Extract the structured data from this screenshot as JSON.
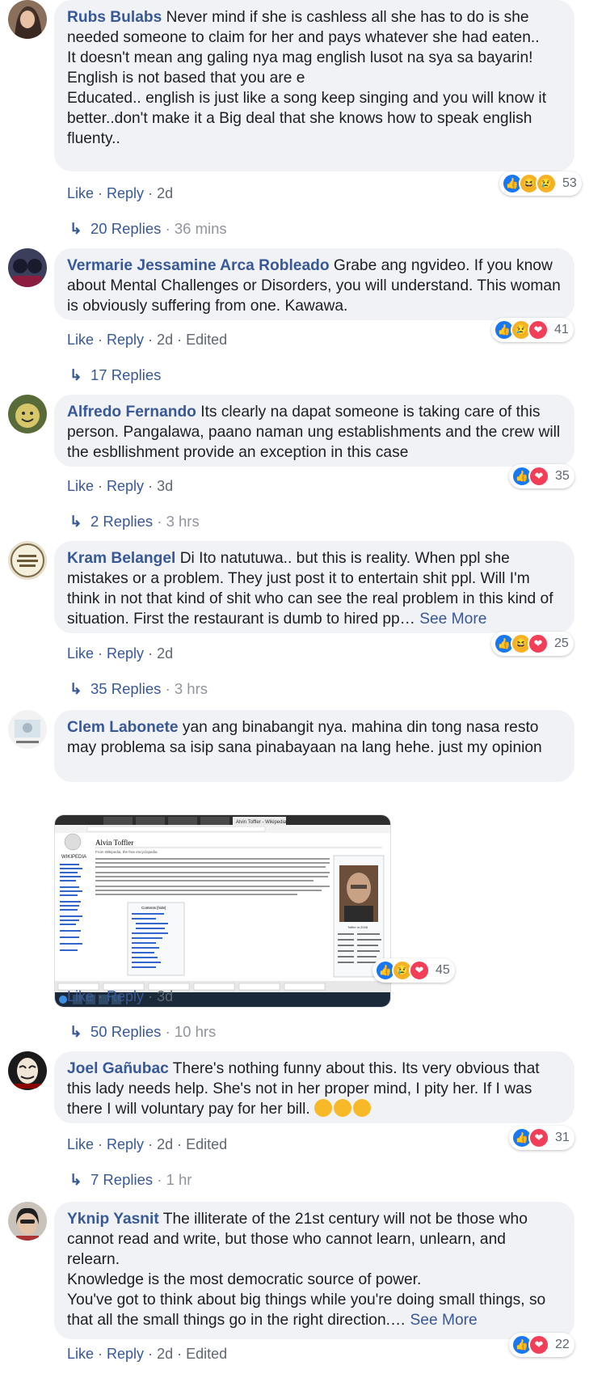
{
  "actions": {
    "like": "Like",
    "reply": "Reply",
    "edited": "Edited",
    "see_more": "See More"
  },
  "comments": [
    {
      "author": "Rubs Bulabs",
      "text": " Never mind if she is cashless all she has to do is she needed someone to claim for her and pays whatever she had eaten..\nIt doesn't mean ang galing nya mag english lusot na sya sa bayarin!\nEnglish is not based that you are e\nEducated.. english is just like a song keep singing and you will know it better..don't make it a Big deal that she knows how to speak english fluenty..",
      "time": "2d",
      "reaction_count": "53",
      "replies": "20 Replies",
      "replies_time": "36 mins"
    },
    {
      "author": "Vermarie Jessamine Arca Robleado",
      "text": " Grabe ang ngvideo. If you know about Mental Challenges or Disorders, you will understand. This woman is obviously suffering from one. Kawawa.",
      "time": "2d",
      "reaction_count": "41",
      "replies": "17 Replies"
    },
    {
      "author": "Alfredo Fernando",
      "text": " Its clearly na dapat someone is taking care of this person. Pangalawa, paano naman ung establishments and the crew will the esbllishment provide an exception in this case",
      "time": "3d",
      "reaction_count": "35",
      "replies": "2 Replies",
      "replies_time": "3 hrs"
    },
    {
      "author": "Kram Belangel",
      "text": " Di Ito natutuwa.. but this is reality. When ppl she mistakes or a problem. They just post it to entertain shit ppl. Will I'm think in not that kind of shit who can see the real problem in this kind of situation. First the restaurant is dumb to hired pp… ",
      "time": "2d",
      "reaction_count": "25",
      "replies": "35 Replies",
      "replies_time": "3 hrs"
    },
    {
      "author": "Clem Labonete",
      "text": " yan ang binabangit nya. mahina din tong nasa resto may problema sa isip sana pinabayaan na lang hehe. just my opinion",
      "time": "3d",
      "reaction_count": "45",
      "replies": "50 Replies",
      "replies_time": "10 hrs",
      "attachment": {
        "tab": "Alvin Toffler - Wikipedia",
        "title": "Alvin Toffler",
        "subtitle": "From Wikipedia, the free encyclopedia",
        "logo": "WIKIPEDIA",
        "contents": "Contents [hide]",
        "caption": "Toffler in 2006"
      }
    },
    {
      "author": "Joel Gañubac",
      "text": " There's nothing funny about this. Its very obvious that this lady needs help. She's not in her proper mind, I pity her. If I was there I will voluntary pay for her bill. ",
      "time": "2d",
      "reaction_count": "31",
      "replies": "7 Replies",
      "replies_time": "1 hr"
    },
    {
      "author": "Yknip Yasnit",
      "text": " The illiterate of the 21st century will not be those who cannot read and write, but those who cannot learn, unlearn, and relearn.\nKnowledge is the most democratic source of power.\nYou've got to think about big things while you're doing small things, so that all the small things go in the right direction.… ",
      "time": "2d",
      "reaction_count": "22"
    }
  ]
}
